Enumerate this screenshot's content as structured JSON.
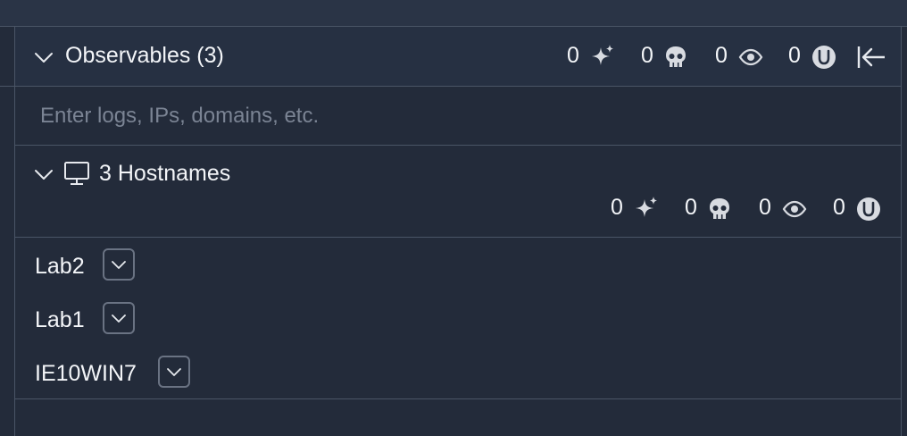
{
  "panel": {
    "title": "Observables (3)",
    "stats": [
      {
        "value": "0",
        "icon": "sparkle-icon"
      },
      {
        "value": "0",
        "icon": "skull-icon"
      },
      {
        "value": "0",
        "icon": "eye-icon"
      },
      {
        "value": "0",
        "icon": "unknown-u-icon"
      }
    ]
  },
  "search": {
    "placeholder": "Enter logs, IPs, domains, etc."
  },
  "group": {
    "title": "3 Hostnames",
    "icon": "monitor-icon",
    "stats": [
      {
        "value": "0",
        "icon": "sparkle-icon"
      },
      {
        "value": "0",
        "icon": "skull-icon"
      },
      {
        "value": "0",
        "icon": "eye-icon"
      },
      {
        "value": "0",
        "icon": "unknown-u-icon"
      }
    ]
  },
  "hosts": [
    {
      "name": "Lab2"
    },
    {
      "name": "Lab1"
    },
    {
      "name": "IE10WIN7"
    }
  ],
  "colors": {
    "background": "#232b3a",
    "header": "#263042",
    "border": "#4a5566",
    "text": "#f3f5f8",
    "placeholder": "#7b8494",
    "icon": "#d8dbe1"
  }
}
